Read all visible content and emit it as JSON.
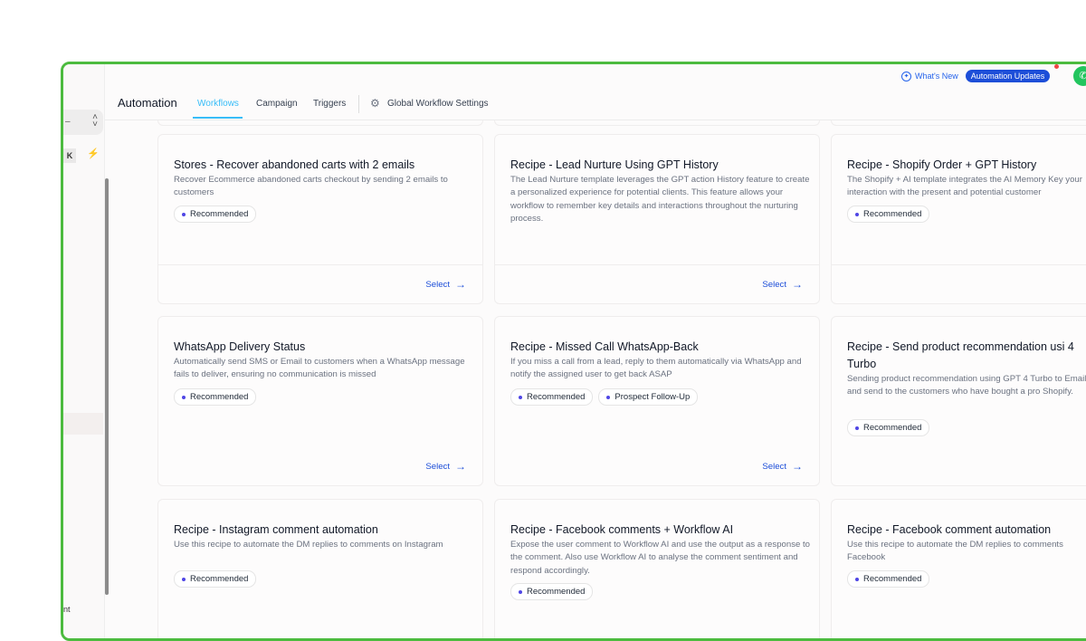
{
  "topbar": {
    "whats_new": "What's New",
    "automation_updates": "Automation Updates"
  },
  "nav": {
    "title": "Automation",
    "tabs": [
      "Workflows",
      "Campaign",
      "Triggers"
    ],
    "active_tab": "Workflows",
    "settings": "Global Workflow Settings"
  },
  "sidebar": {
    "k_label": "K",
    "bottom_text": "nt"
  },
  "cards": [
    {
      "title": "Stores - Recover abandoned carts with 2 emails",
      "desc": "Recover Ecommerce abandoned carts checkout by sending 2 emails to customers",
      "tags": [
        "Recommended"
      ],
      "select": "Select"
    },
    {
      "title": "Recipe - Lead Nurture Using GPT History",
      "desc": "The Lead Nurture template leverages the GPT action History feature to create a personalized experience for potential clients. This feature allows your workflow to remember key details and interactions throughout the nurturing process.",
      "tags": [
        "Recommended"
      ],
      "select": "Select"
    },
    {
      "title": "Recipe - Shopify Order + GPT History",
      "desc": "The Shopify + AI template integrates the AI Memory Key your interaction with the present and potential customer",
      "tags": [
        "Recommended"
      ],
      "select": ""
    },
    {
      "title": "WhatsApp Delivery Status",
      "desc": "Automatically send SMS or Email to customers when a WhatsApp message fails to deliver, ensuring no communication is missed",
      "tags": [
        "Recommended"
      ],
      "select": "Select"
    },
    {
      "title": "Recipe - Missed Call WhatsApp-Back",
      "desc": "If you miss a call from a lead, reply to them automatically via WhatsApp and notify the assigned user to get back ASAP",
      "tags": [
        "Recommended",
        "Prospect Follow-Up"
      ],
      "select": "Select"
    },
    {
      "title": "Recipe - Send product recommendation usi 4 Turbo",
      "desc": "Sending product recommendation using GPT 4 Turbo to Email and send to the customers who have bought a pro Shopify.",
      "tags": [
        "Recommended"
      ],
      "select": ""
    },
    {
      "title": "Recipe - Instagram comment automation",
      "desc": "Use this recipe to automate the DM replies to comments on Instagram",
      "tags": [
        "Recommended"
      ],
      "select": ""
    },
    {
      "title": "Recipe - Facebook comments + Workflow AI",
      "desc": "Expose the user comment to Workflow AI and use the output as a response to the comment. Also use Workflow AI to analyse the comment sentiment and respond accordingly.",
      "tags": [
        "Recommended"
      ],
      "select": ""
    },
    {
      "title": "Recipe - Facebook comment automation",
      "desc": "Use this recipe to automate the DM replies to comments Facebook",
      "tags": [
        "Recommended"
      ],
      "select": ""
    }
  ]
}
